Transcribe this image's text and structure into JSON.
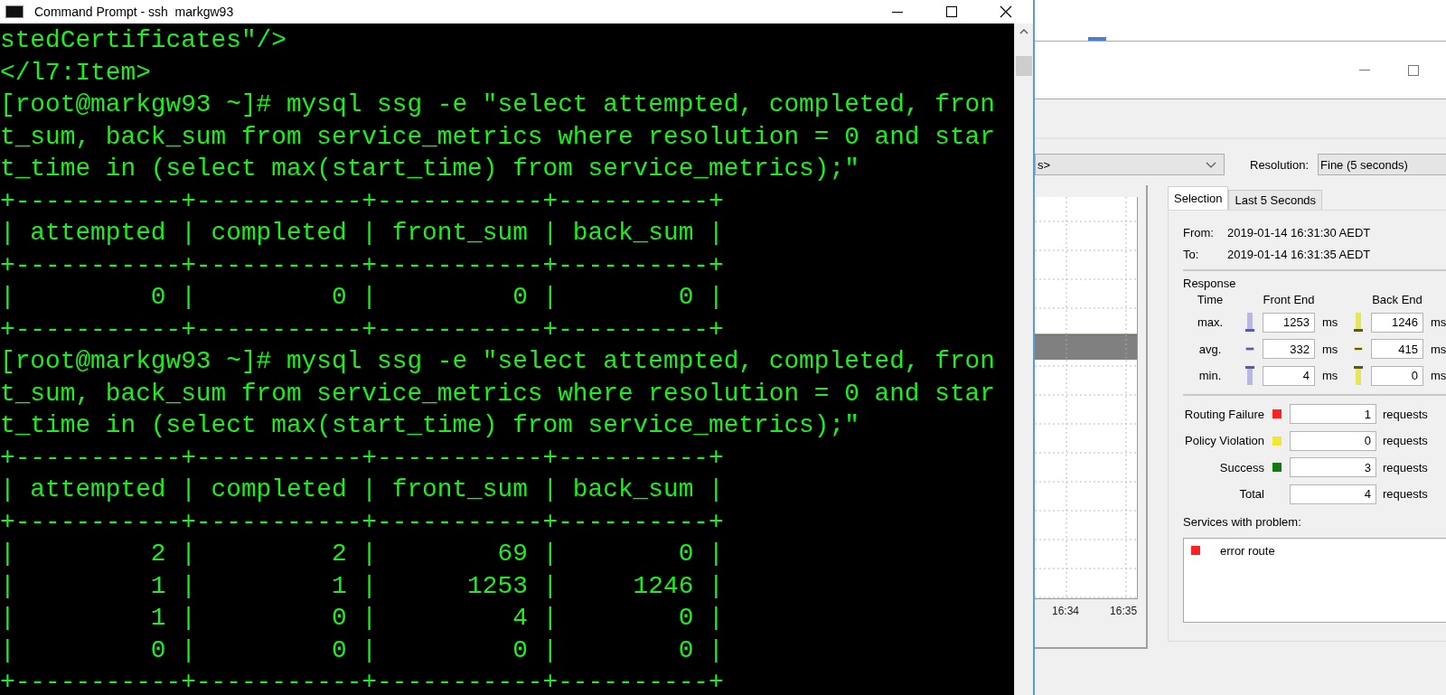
{
  "terminal": {
    "title": "Command Prompt - ssh  markgw93",
    "lines": [
      "stedCertificates\"/>",
      "</l7:Item>",
      "[root@markgw93 ~]# mysql ssg -e \"select attempted, completed, fron",
      "t_sum, back_sum from service_metrics where resolution = 0 and star",
      "t_time in (select max(start_time) from service_metrics);\"",
      "+-----------+-----------+-----------+----------+",
      "| attempted | completed | front_sum | back_sum |",
      "+-----------+-----------+-----------+----------+",
      "|         0 |         0 |         0 |        0 |",
      "+-----------+-----------+-----------+----------+",
      "[root@markgw93 ~]# mysql ssg -e \"select attempted, completed, fron",
      "t_sum, back_sum from service_metrics where resolution = 0 and star",
      "t_time in (select max(start_time) from service_metrics);\"",
      "+-----------+-----------+-----------+----------+",
      "| attempted | completed | front_sum | back_sum |",
      "+-----------+-----------+-----------+----------+",
      "|         2 |         2 |        69 |        0 |",
      "|         1 |         1 |      1253 |     1246 |",
      "|         1 |         0 |         4 |        0 |",
      "|         0 |         0 |         0 |        0 |",
      "+-----------+-----------+-----------+----------+"
    ]
  },
  "monitor": {
    "service_dropdown": {
      "value": "s>"
    },
    "resolution": {
      "label": "Resolution:",
      "value": "Fine (5 seconds)"
    },
    "chart": {
      "x_labels": [
        "16:34",
        "16:35"
      ]
    },
    "tabs": [
      {
        "label": "Selection",
        "selected": true
      },
      {
        "label": "Last 5 Seconds",
        "selected": false
      }
    ],
    "from": {
      "label": "From:",
      "value": "2019-01-14 16:31:30 AEDT"
    },
    "to": {
      "label": "To:",
      "value": "2019-01-14 16:31:35 AEDT"
    },
    "response": {
      "heading": "Response",
      "subheading": "Time",
      "columns": [
        "Front End",
        "Back End"
      ],
      "rows": [
        {
          "label": "max.",
          "kind": "max",
          "front": "1253",
          "front_unit": "ms",
          "back": "1246",
          "back_unit": "ms"
        },
        {
          "label": "avg.",
          "kind": "avg",
          "front": "332",
          "front_unit": "ms",
          "back": "415",
          "back_unit": "ms"
        },
        {
          "label": "min.",
          "kind": "min",
          "front": "4",
          "front_unit": "ms",
          "back": "0",
          "back_unit": "ms"
        }
      ]
    },
    "counts": [
      {
        "label": "Routing Failure",
        "color": "#ff2020",
        "value": "1",
        "unit": "requests"
      },
      {
        "label": "Policy Violation",
        "color": "#f0e830",
        "value": "0",
        "unit": "requests"
      },
      {
        "label": "Success",
        "color": "#107810",
        "value": "3",
        "unit": "requests"
      },
      {
        "label": "Total",
        "value": "4",
        "unit": "requests"
      }
    ],
    "problems": {
      "label": "Services with problem:",
      "items": [
        {
          "name": "error route",
          "color": "#ff2020"
        }
      ]
    }
  }
}
